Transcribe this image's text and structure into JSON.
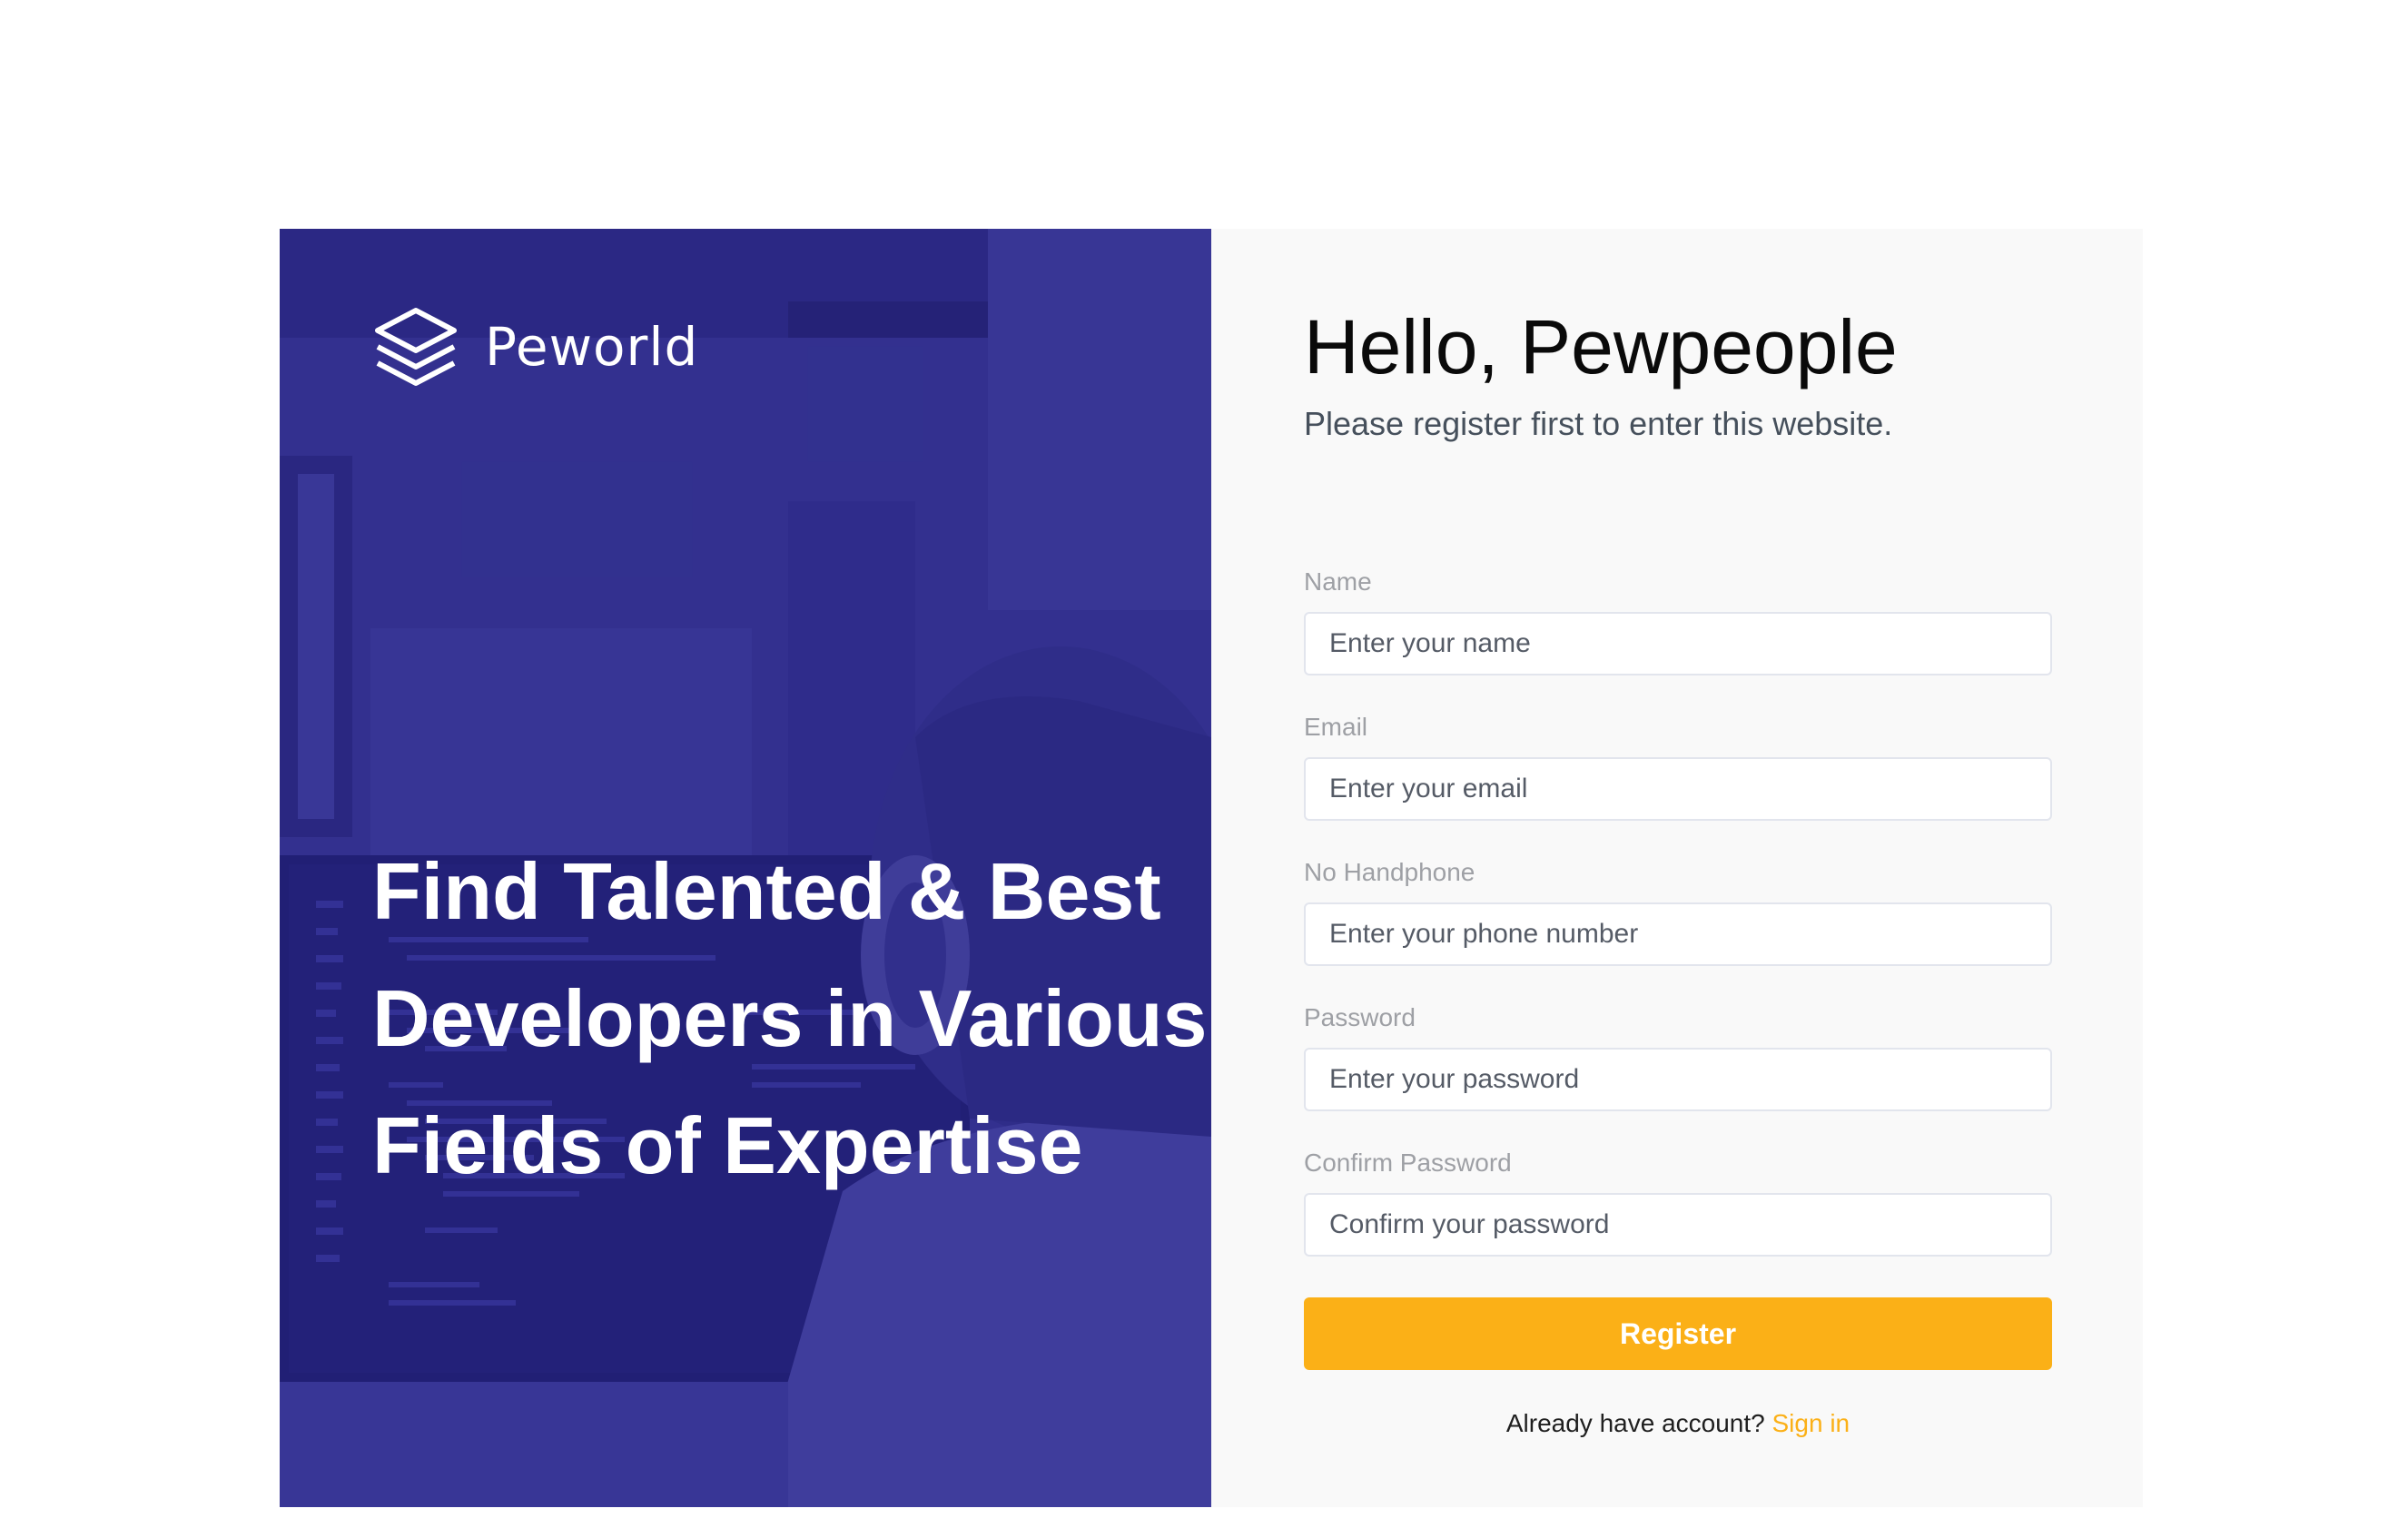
{
  "colors": {
    "hero_overlay": "#29278c",
    "form_background": "#f9f9f9",
    "accent": "#fbb017",
    "label": "#9ea0a5",
    "input_border": "#e2e5ed"
  },
  "hero": {
    "logo_icon": "stacked-layers-icon",
    "brand_name": "Peworld",
    "headline": "Find Talented & Best Developers in Various Fields of Expertise"
  },
  "form": {
    "greeting": "Hello, Pewpeople",
    "subtitle": "Please register first to enter this website.",
    "fields": [
      {
        "label": "Name",
        "placeholder": "Enter your name",
        "type": "text",
        "value": ""
      },
      {
        "label": "Email",
        "placeholder": "Enter your email",
        "type": "email",
        "value": ""
      },
      {
        "label": "No Handphone",
        "placeholder": "Enter your phone number",
        "type": "tel",
        "value": ""
      },
      {
        "label": "Password",
        "placeholder": "Enter your password",
        "type": "password",
        "value": ""
      },
      {
        "label": "Confirm Password",
        "placeholder": "Confirm your password",
        "type": "password",
        "value": ""
      }
    ],
    "submit_label": "Register",
    "signin_prompt": "Already have account?",
    "signin_link": "Sign in"
  }
}
